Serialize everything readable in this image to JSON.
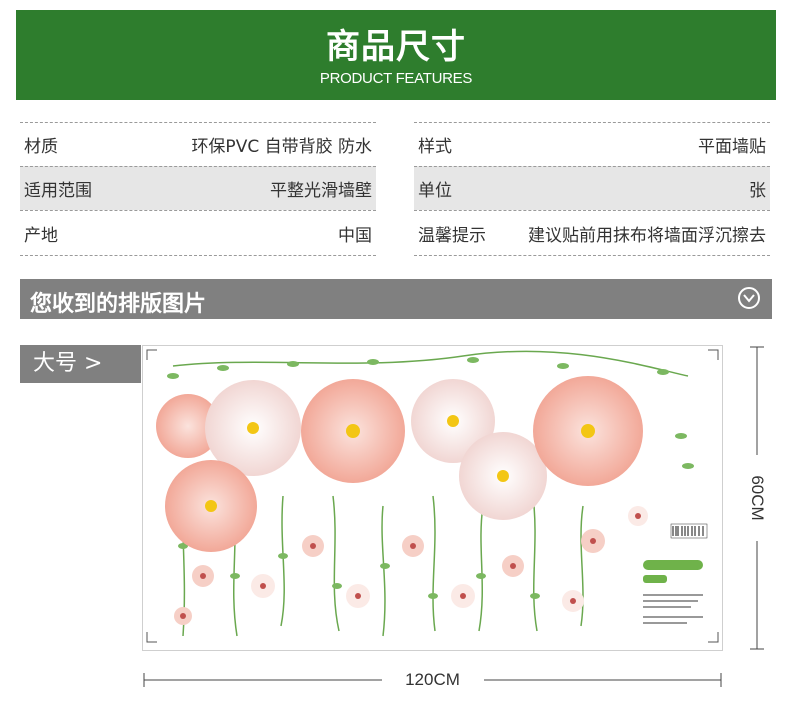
{
  "header": {
    "title": "商品尺寸",
    "subtitle": "PRODUCT FEATURES"
  },
  "specs_left": [
    {
      "label": "材质",
      "value": "环保PVC 自带背胶 防水"
    },
    {
      "label": "适用范围",
      "value": "平整光滑墙壁"
    },
    {
      "label": "产地",
      "value": "中国"
    }
  ],
  "specs_right": [
    {
      "label": "样式",
      "value": "平面墙贴"
    },
    {
      "label": "单位",
      "value": "张"
    },
    {
      "label": "温馨提示",
      "value": "建议贴前用抹布将墙面浮沉擦去"
    }
  ],
  "section": {
    "title": "您收到的排版图片",
    "icon": "chevron-down-circle-icon"
  },
  "size_tag": "大号 >",
  "dimensions": {
    "height_label": "60CM",
    "width_label": "120CM"
  },
  "colors": {
    "banner_green": "#2e7d2d",
    "section_gray": "#808080",
    "row_shade": "#e6e6e6"
  }
}
